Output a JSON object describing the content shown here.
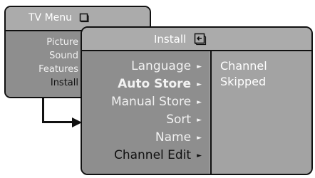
{
  "tv_menu": {
    "title": "TV Menu",
    "title_icon": "tv-icon",
    "items": [
      {
        "label": "Picture"
      },
      {
        "label": "Sound"
      },
      {
        "label": "Features"
      },
      {
        "label": "Install"
      }
    ]
  },
  "install_menu": {
    "title": "Install",
    "title_icon": "submenu-icon",
    "items": [
      {
        "label": "Language",
        "arrow": "►"
      },
      {
        "label": "Auto Store",
        "arrow": "►"
      },
      {
        "label": "Manual Store",
        "arrow": "►"
      },
      {
        "label": "Sort",
        "arrow": "►"
      },
      {
        "label": "Name",
        "arrow": "►"
      },
      {
        "label": "Channel Edit",
        "arrow": "►"
      }
    ],
    "submenu": [
      "Channel",
      "Skipped"
    ]
  },
  "colors": {
    "window_bg": "#9a9a9a",
    "title_bg": "#ababab",
    "submenu_bg": "#a3a3a3",
    "text_light": "#f2f2f2",
    "text_active": "#111111"
  }
}
